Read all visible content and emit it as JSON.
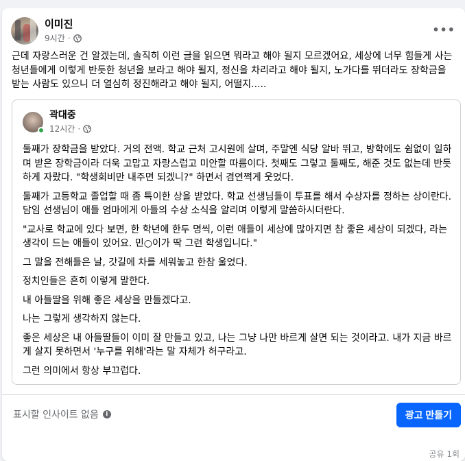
{
  "post": {
    "author": "이미진",
    "time": "9시간",
    "privacy_icon": "globe-icon",
    "more_icon": "more-horizontal-icon",
    "text": "근데 자랑스러운 건 알겠는데, 솔직히 이런 글을 읽으면 뭐라고 해야 될지 모르겠어요, 세상에 너무 힘들게 사는 청년들에게 이렇게 반듯한 청년을 보라고 해야 될지, 정신을 차리라고 해야 될지, 노가다를 뛰더라도 장학금을 받는 사람도 있으니 더 열심히 정진해라고 해야 될지, 어떨지....."
  },
  "shared": {
    "author": "곽대중",
    "time": "12시간",
    "privacy_icon": "globe-icon",
    "online_color": "#31a24c",
    "paragraphs": [
      "둘째가 장학금을 받았다. 거의 전액. 학교 근처 고시원에 살며, 주말엔 식당 알바 뛰고, 방학에도 쉼없이 일하며 받은 장학금이라 더욱 고맙고 자랑스럽고 미안할 따름이다. 첫째도 그렇고 둘째도, 해준 것도 없는데 반듯하게 자랐다. \"학생회비만 내주면 되겠니?\" 하면서 겸연쩍게 웃었다.",
      "둘째가 고등학교 졸업할 때 좀 특이한 상을 받았다. 학교 선생님들이 투표를 해서 수상자를 정하는 상이란다. 담임 선생님이 애들 엄마에게 아들의 수상 소식을 알리며 이렇게 말씀하시더란다.",
      "\"교사로 학교에 있다 보면, 한 학년에 한두 명씩, 이런 애들이 세상에 많아지면 참 좋은 세상이 되겠다, 라는 생각이 드는 애들이 있어요. 민○이가 딱 그런 학생입니다.\"",
      "그 말을 전해들은 날, 갓길에 차를 세워놓고 한참 울었다.",
      "정치인들은 흔히 이렇게 말한다.",
      "내 아들딸을 위해 좋은 세상을 만들겠다고.",
      "나는 그렇게 생각하지 않는다.",
      "좋은 세상은 내 아들딸들이 이미 잘 만들고 있고, 나는 그냥 나만 바르게 살면 되는 것이라고. 내가 지금 바르게 살지 못하면서 '누구를 위해'라는 말 자체가 허구라고.",
      "그런 의미에서 항상 부끄럽다."
    ]
  },
  "footer": {
    "insight_text": "표시할 인사이트 없음",
    "info_icon": "info-icon",
    "ad_button": "광고 만들기",
    "accent_color": "#0866ff",
    "cutoff_text": "공유 1회"
  }
}
